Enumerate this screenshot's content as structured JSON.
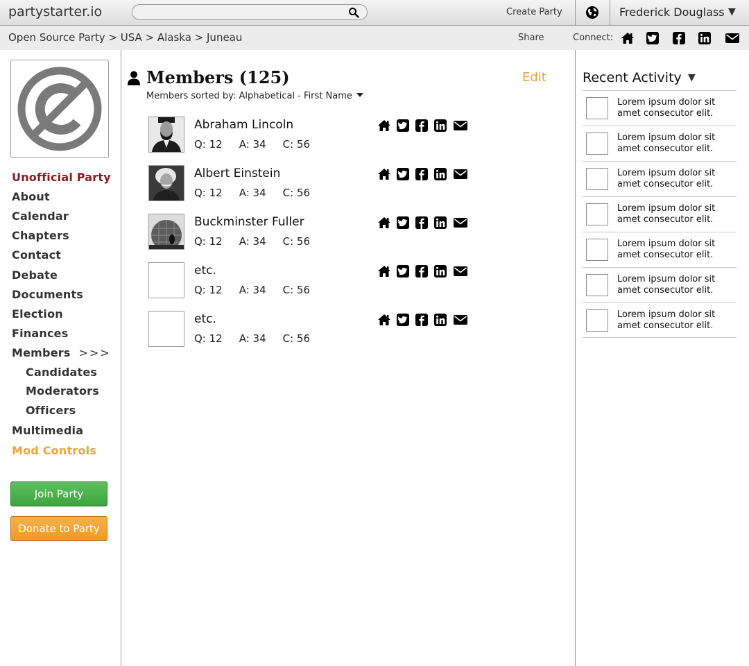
{
  "topbar": {
    "brand": "partystarter.io",
    "search_placeholder": "",
    "create_party": "Create Party",
    "user_name": "Frederick Douglass",
    "user_caret": "▼"
  },
  "breadcrumb": {
    "path": "Open Source Party > USA > Alaska > Juneau",
    "share": "Share",
    "connect": "Connect:"
  },
  "sidebar": {
    "items": [
      {
        "label": "Unofficial Party"
      },
      {
        "label": "About"
      },
      {
        "label": "Calendar"
      },
      {
        "label": "Chapters"
      },
      {
        "label": "Contact"
      },
      {
        "label": "Debate"
      },
      {
        "label": "Documents"
      },
      {
        "label": "Election"
      },
      {
        "label": "Finances"
      },
      {
        "label": "Members",
        "suffix": ">>>"
      },
      {
        "label": "Candidates"
      },
      {
        "label": "Moderators"
      },
      {
        "label": "Officers"
      },
      {
        "label": "Multimedia"
      },
      {
        "label": "Mod Controls"
      }
    ],
    "join_button": "Join Party",
    "donate_button": "Donate to Party"
  },
  "main": {
    "title": "Members (125)",
    "edit": "Edit",
    "sorted_by": "Members sorted by: Alphabetical - First Name",
    "members": [
      {
        "name": "Abraham Lincoln",
        "q": "Q: 12",
        "a": "A: 34",
        "c": "C: 56"
      },
      {
        "name": "Albert Einstein",
        "q": "Q: 12",
        "a": "A: 34",
        "c": "C: 56"
      },
      {
        "name": "Buckminster Fuller",
        "q": "Q: 12",
        "a": "A: 34",
        "c": "C: 56"
      },
      {
        "name": "etc.",
        "q": "Q: 12",
        "a": "A: 34",
        "c": "C: 56"
      },
      {
        "name": "etc.",
        "q": "Q: 12",
        "a": "A: 34",
        "c": "C: 56"
      }
    ]
  },
  "recent": {
    "title": "Recent Activity",
    "caret": "▼",
    "items": [
      {
        "text": "Lorem ipsum dolor sit amet consecutor elit."
      },
      {
        "text": "Lorem ipsum dolor sit amet consecutor elit."
      },
      {
        "text": "Lorem ipsum dolor sit amet consecutor elit."
      },
      {
        "text": "Lorem ipsum dolor sit amet consecutor elit."
      },
      {
        "text": "Lorem ipsum dolor sit amet consecutor elit."
      },
      {
        "text": "Lorem ipsum dolor sit amet consecutor elit."
      },
      {
        "text": "Lorem ipsum dolor sit amet consecutor elit."
      }
    ]
  },
  "icons": [
    "search-icon",
    "globe-icon",
    "home-icon",
    "twitter-icon",
    "facebook-icon",
    "linkedin-icon",
    "email-icon",
    "person-icon",
    "no-copyright-logo"
  ],
  "colors": {
    "party_red": "#8b1a1a",
    "mod_orange": "#f0a53a",
    "join_green": "#4cb34c",
    "donate_orange": "#f0a53a"
  }
}
